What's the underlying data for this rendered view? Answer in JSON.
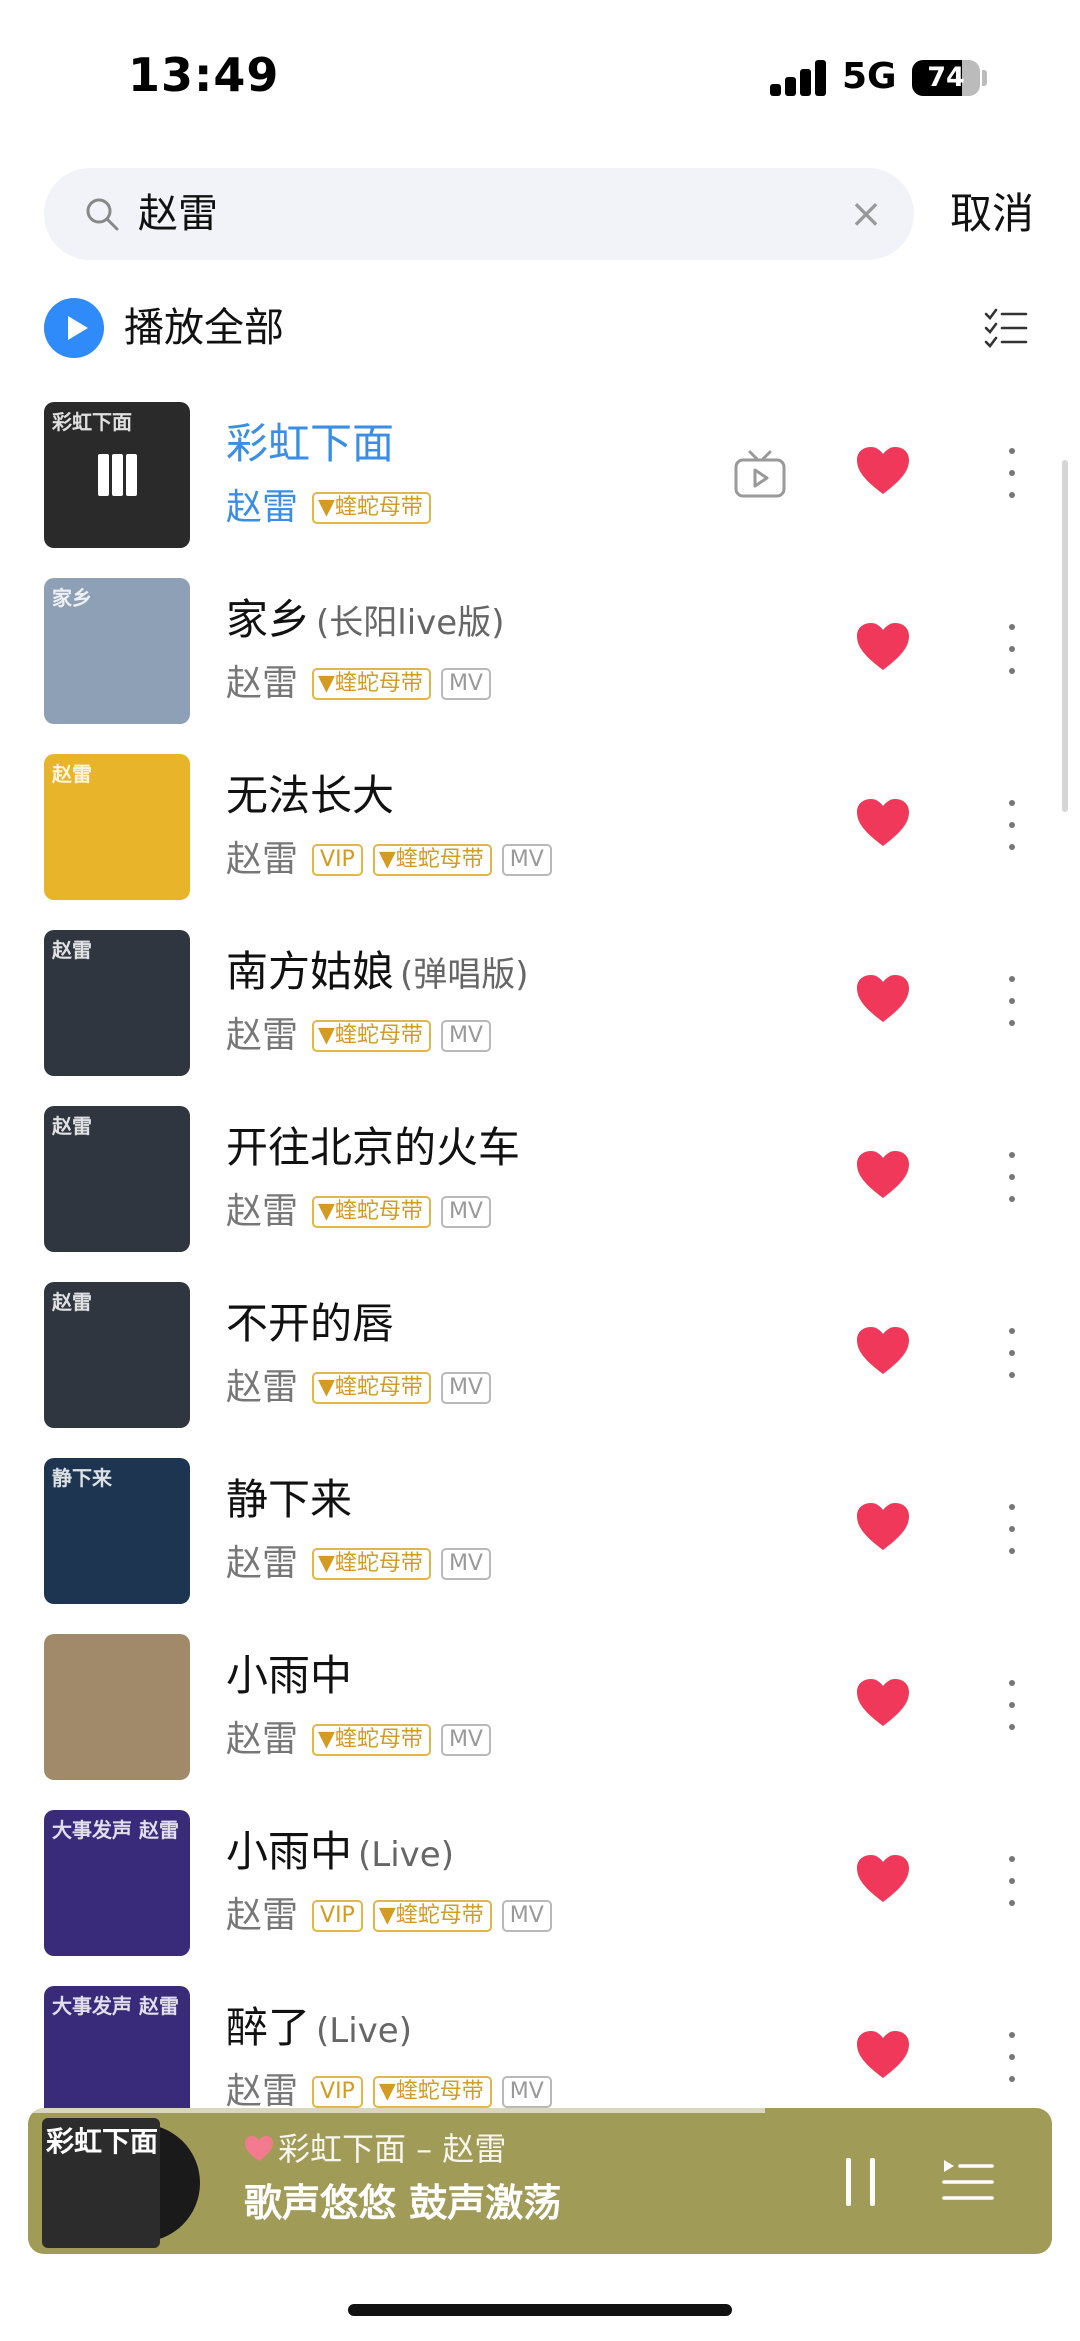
{
  "status": {
    "time": "13:49",
    "network": "5G",
    "battery": "74",
    "battery_level": 0.74
  },
  "search": {
    "query": "赵雷",
    "cancel_label": "取消"
  },
  "toolbar": {
    "play_all_label": "播放全部"
  },
  "songs": [
    {
      "title": "彩虹下面",
      "version": "",
      "artist": "赵雷",
      "tags": [
        "蝰蛇母带"
      ],
      "has_mv_icon": true,
      "cover_text": "彩虹下面",
      "cover_color": "#2a2a2a",
      "playing": true
    },
    {
      "title": "家乡",
      "version": "(长阳live版)",
      "artist": "赵雷",
      "tags": [
        "蝰蛇母带",
        "MV"
      ],
      "cover_text": "家乡",
      "cover_color": "#8ea0b6"
    },
    {
      "title": "无法长大",
      "version": "",
      "artist": "赵雷",
      "tags": [
        "VIP",
        "蝰蛇母带",
        "MV"
      ],
      "cover_text": "赵雷",
      "cover_color": "#e8b42a"
    },
    {
      "title": "南方姑娘",
      "version": "(弹唱版)",
      "artist": "赵雷",
      "tags": [
        "蝰蛇母带",
        "MV"
      ],
      "cover_text": "赵雷",
      "cover_color": "#2f3640"
    },
    {
      "title": "开往北京的火车",
      "version": "",
      "artist": "赵雷",
      "tags": [
        "蝰蛇母带",
        "MV"
      ],
      "cover_text": "赵雷",
      "cover_color": "#2f3640"
    },
    {
      "title": "不开的唇",
      "version": "",
      "artist": "赵雷",
      "tags": [
        "蝰蛇母带",
        "MV"
      ],
      "cover_text": "赵雷",
      "cover_color": "#2f3640"
    },
    {
      "title": "静下来",
      "version": "",
      "artist": "赵雷",
      "tags": [
        "蝰蛇母带",
        "MV"
      ],
      "cover_text": "静下来",
      "cover_color": "#1d3550"
    },
    {
      "title": "小雨中",
      "version": "",
      "artist": "赵雷",
      "tags": [
        "蝰蛇母带",
        "MV"
      ],
      "cover_text": "",
      "cover_color": "#a08a6a"
    },
    {
      "title": "小雨中",
      "version": "(Live)",
      "artist": "赵雷",
      "tags": [
        "VIP",
        "蝰蛇母带",
        "MV"
      ],
      "cover_text": "大事发声 赵雷",
      "cover_color": "#3a2a7a"
    },
    {
      "title": "醉了",
      "version": "(Live)",
      "artist": "赵雷",
      "tags": [
        "VIP",
        "蝰蛇母带",
        "MV"
      ],
      "cover_text": "大事发声 赵雷",
      "cover_color": "#3a2a7a"
    }
  ],
  "player": {
    "now_playing": "彩虹下面 – 赵雷",
    "lyric": "歌声悠悠 鼓声激荡",
    "art_text": "彩虹下面",
    "progress": 0.72
  },
  "colors": {
    "accent": "#2f8bfa",
    "heart": "#f0385a",
    "tag_gold": "#d39b21",
    "player_bg": "#a19b58"
  }
}
